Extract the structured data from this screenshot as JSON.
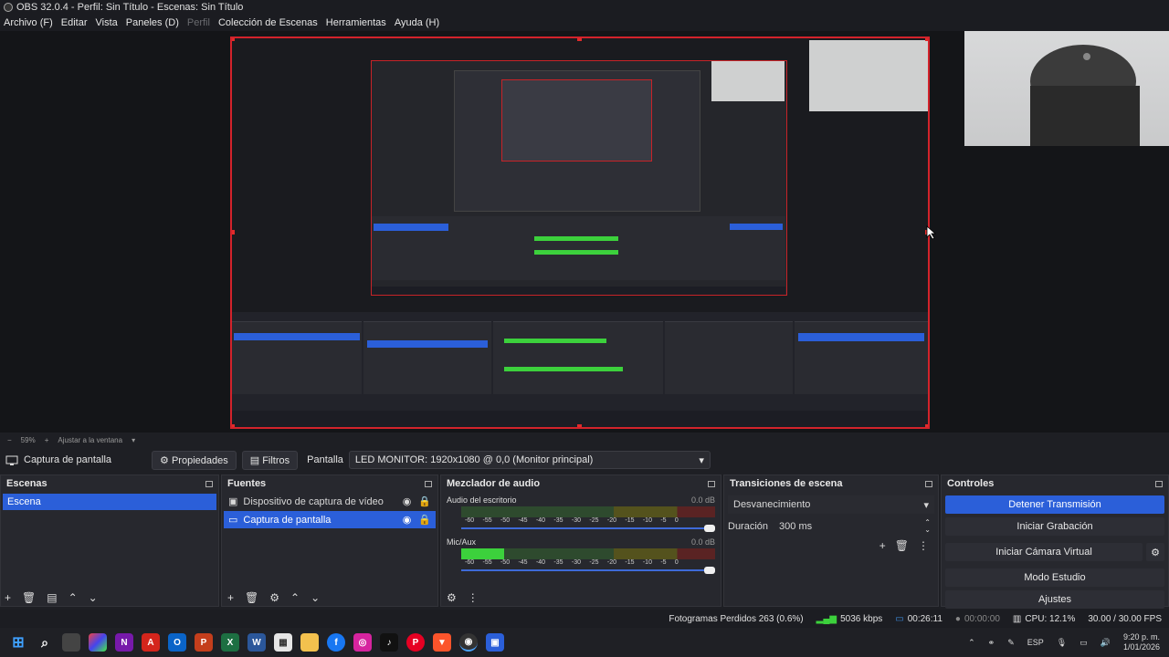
{
  "window": {
    "title": "OBS 32.0.4 - Perfil: Sin Título - Escenas: Sin Título"
  },
  "menu": {
    "items": [
      {
        "label": "Archivo (F)",
        "disabled": false
      },
      {
        "label": "Editar",
        "disabled": false
      },
      {
        "label": "Vista",
        "disabled": false
      },
      {
        "label": "Paneles (D)",
        "disabled": false
      },
      {
        "label": "Perfil",
        "disabled": true
      },
      {
        "label": "Colección de Escenas",
        "disabled": false
      },
      {
        "label": "Herramientas",
        "disabled": false
      },
      {
        "label": "Ayuda (H)",
        "disabled": false
      }
    ]
  },
  "preview": {
    "zoom": "59%",
    "fit_label": "Ajustar a la ventana"
  },
  "source_bar": {
    "source_name": "Captura de pantalla",
    "properties_label": "Propiedades",
    "filters_label": "Filtros",
    "screen_label": "Pantalla",
    "screen_value": "LED MONITOR: 1920x1080 @ 0,0 (Monitor principal)"
  },
  "scenes": {
    "title": "Escenas",
    "items": [
      "Escena"
    ]
  },
  "sources": {
    "title": "Fuentes",
    "items": [
      {
        "label": "Dispositivo de captura de vídeo",
        "selected": false
      },
      {
        "label": "Captura de pantalla",
        "selected": true
      }
    ]
  },
  "mixer": {
    "title": "Mezclador de audio",
    "channels": [
      {
        "name": "Audio del escritorio",
        "db": "0.0 dB",
        "level": 0.0
      },
      {
        "name": "Mic/Aux",
        "db": "0.0 dB",
        "level": 0.17
      }
    ],
    "ticks": [
      "-60",
      "-55",
      "-50",
      "-45",
      "-40",
      "-35",
      "-30",
      "-25",
      "-20",
      "-15",
      "-10",
      "-5",
      "0"
    ]
  },
  "transitions": {
    "title": "Transiciones de escena",
    "selected": "Desvanecimiento",
    "duration_label": "Duración",
    "duration_value": "300 ms"
  },
  "controls": {
    "title": "Controles",
    "stop_stream": "Detener Transmisión",
    "start_recording": "Iniciar Grabación",
    "start_virtual_cam": "Iniciar Cámara Virtual",
    "studio_mode": "Modo Estudio",
    "settings": "Ajustes"
  },
  "status": {
    "dropped_frames": "Fotogramas Perdidos 263 (0.6%)",
    "bitrate": "5036 kbps",
    "stream_time": "00:26:11",
    "rec_time": "00:00:00",
    "cpu": "CPU: 12.1%",
    "fps": "30.00 / 30.00 FPS"
  },
  "taskbar": {
    "lang": "ESP",
    "time": "9:20 p. m.",
    "date": "1/01/2026"
  },
  "colors": {
    "accent": "#2b5fd9",
    "selection_border": "#d3232b",
    "meter_green": "#3cd13c"
  }
}
